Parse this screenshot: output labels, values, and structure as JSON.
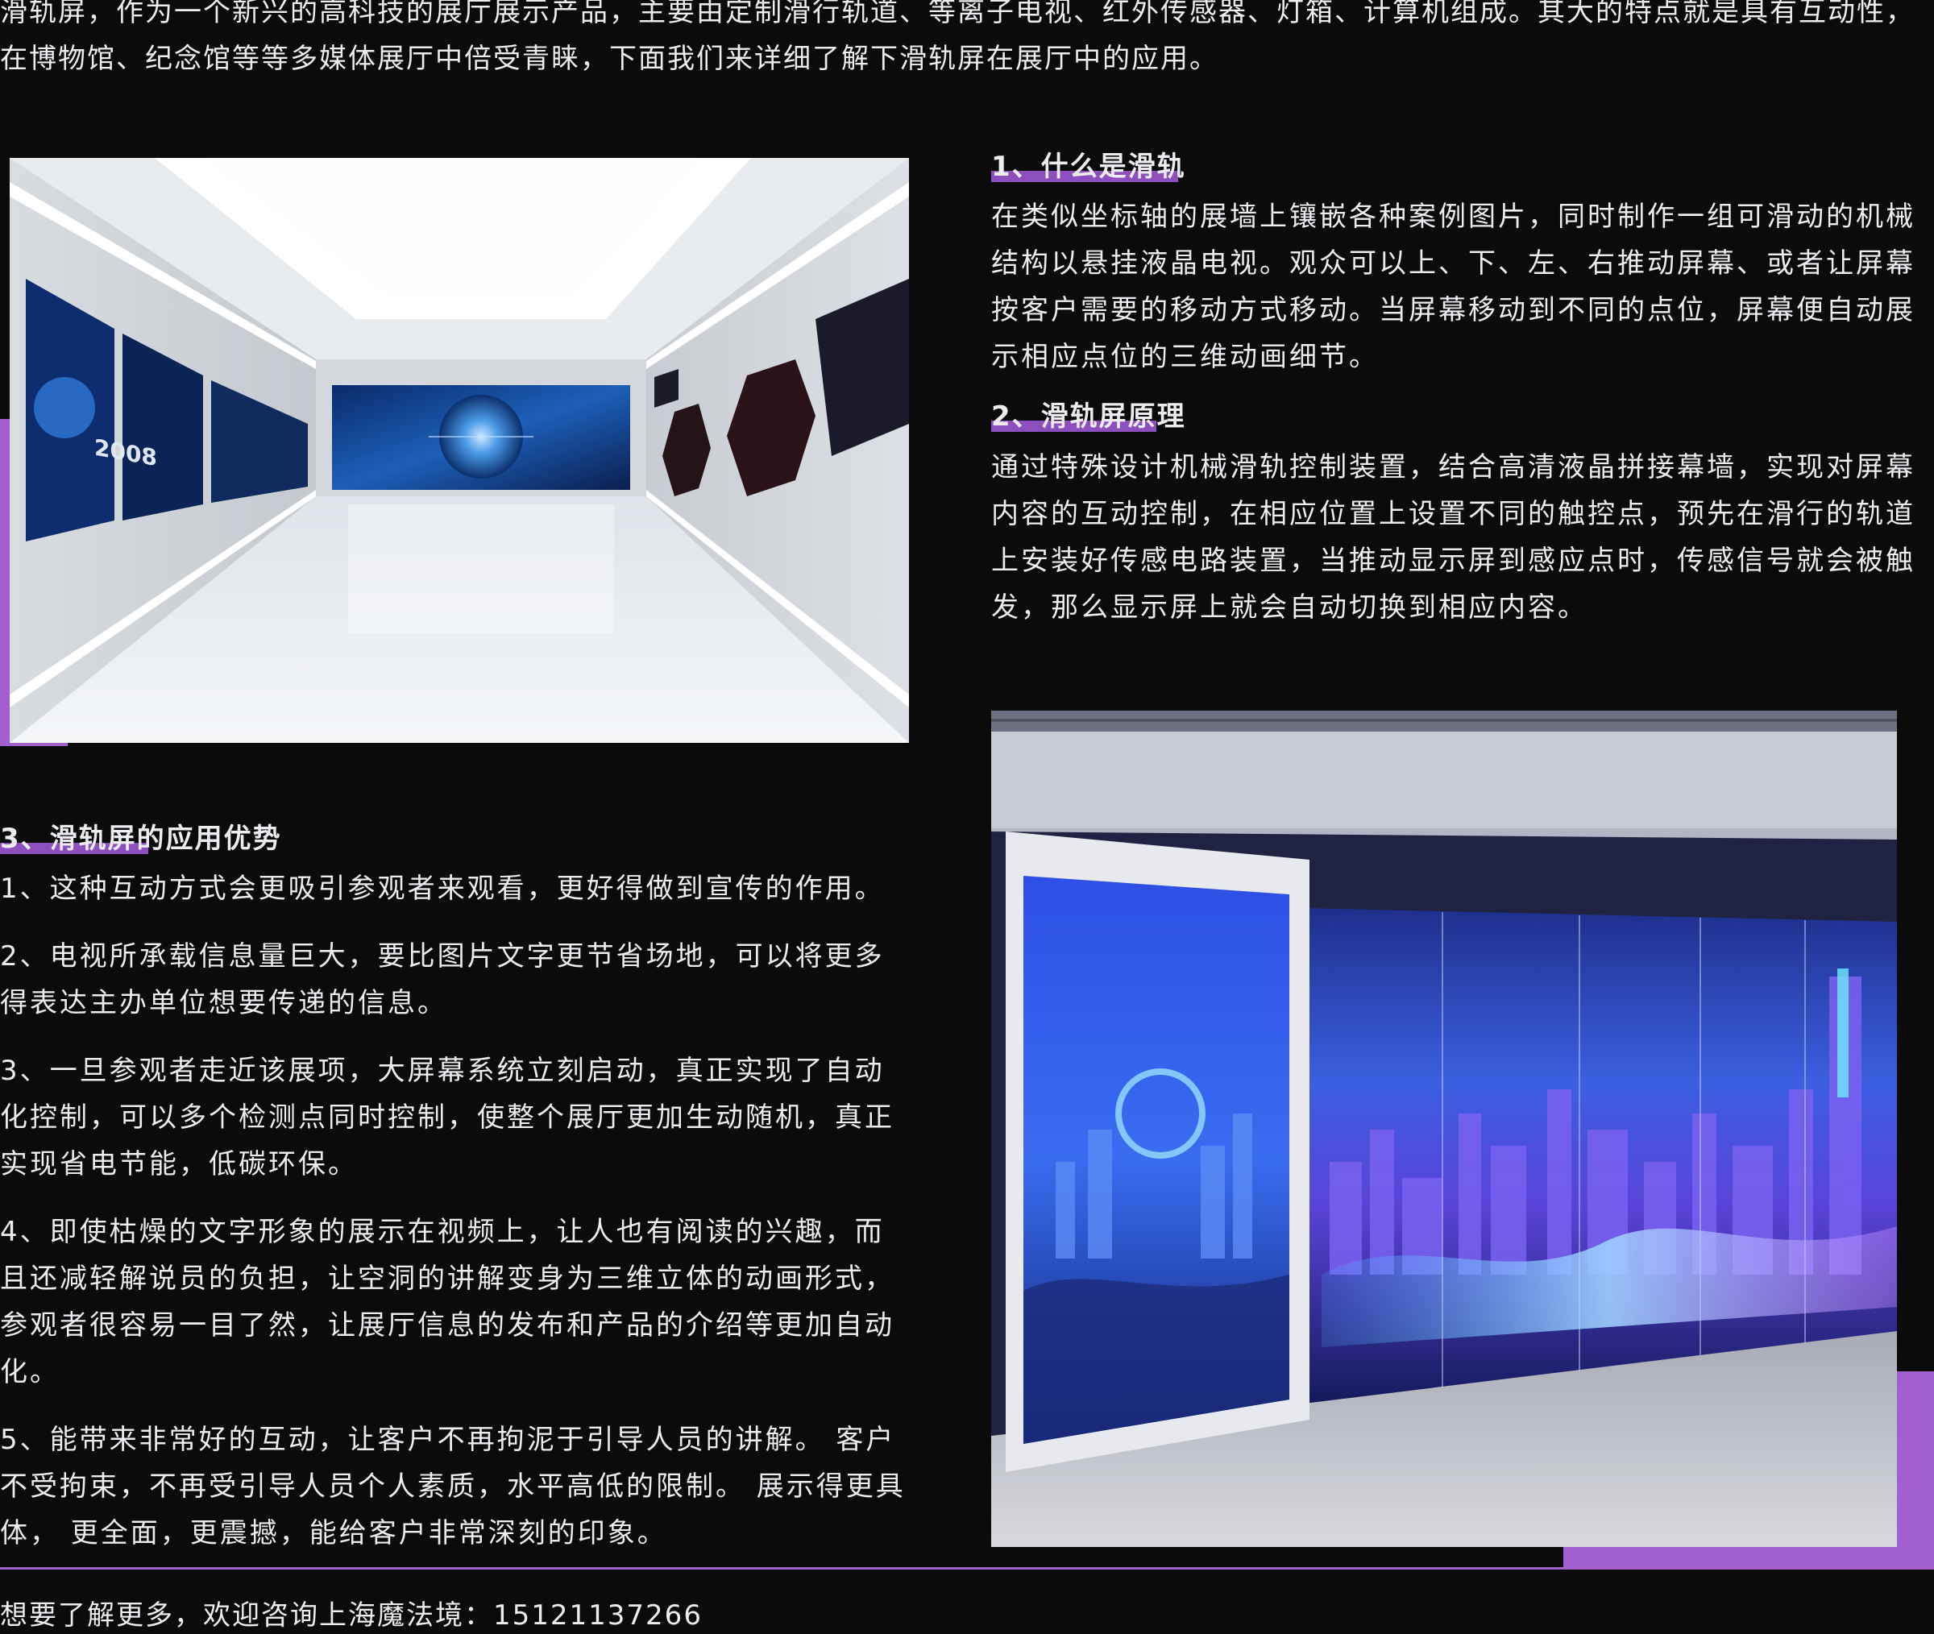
{
  "intro": "滑轨屏，作为一个新兴的高科技的展厅展示产品，主要由定制滑行轨道、等离子电视、红外传感器、灯箱、计算机组成。其大的特点就是具有互动性，在博物馆、纪念馆等等多媒体展厅中倍受青睐，下面我们来详细了解下滑轨屏在展厅中的应用。",
  "sections": {
    "what": {
      "title": "1、什么是滑轨",
      "text": "在类似坐标轴的展墙上镶嵌各种案例图片，同时制作一组可滑动的机械结构以悬挂液晶电视。观众可以上、下、左、右推动屏幕、或者让屏幕按客户需要的移动方式移动。当屏幕移动到不同的点位，屏幕便自动展示相应点位的三维动画细节。"
    },
    "principle": {
      "title": "2、滑轨屏原理",
      "text": "通过特殊设计机械滑轨控制装置，结合高清液晶拼接幕墙，实现对屏幕内容的互动控制，在相应位置上设置不同的触控点，预先在滑行的轨道上安装好传感电路装置，当推动显示屏到感应点时，传感信号就会被触发，那么显示屏上就会自动切换到相应内容。"
    },
    "advantages": {
      "title": "3、滑轨屏的应用优势",
      "items": [
        "1、这种互动方式会更吸引参观者来观看，更好得做到宣传的作用。",
        "2、电视所承载信息量巨大，要比图片文字更节省场地，可以将更多得表达主办单位想要传递的信息。",
        "3、一旦参观者走近该展项，大屏幕系统立刻启动，真正实现了自动化控制，可以多个检测点同时控制，使整个展厅更加生动随机，真正实现省电节能，低碳环保。",
        "4、即使枯燥的文字形象的展示在视频上，让人也有阅读的兴趣，而且还减轻解说员的负担，让空洞的讲解变身为三维立体的动画形式，参观者很容易一目了然，让展厅信息的发布和产品的介绍等更加自动化。",
        "5、能带来非常好的互动，让客户不再拘泥于引导人员的讲解。  客户不受拘束，不再受引导人员个人素质，水平高低的限制。  展示得更具体，  更全面，更震撼，能给客户非常深刻的印象。"
      ]
    }
  },
  "footer": "想要了解更多，欢迎咨询上海魔法境：15121137266",
  "colors": {
    "background": "#0b0b0c",
    "text": "#ececf1",
    "accent": "#a25fce"
  }
}
